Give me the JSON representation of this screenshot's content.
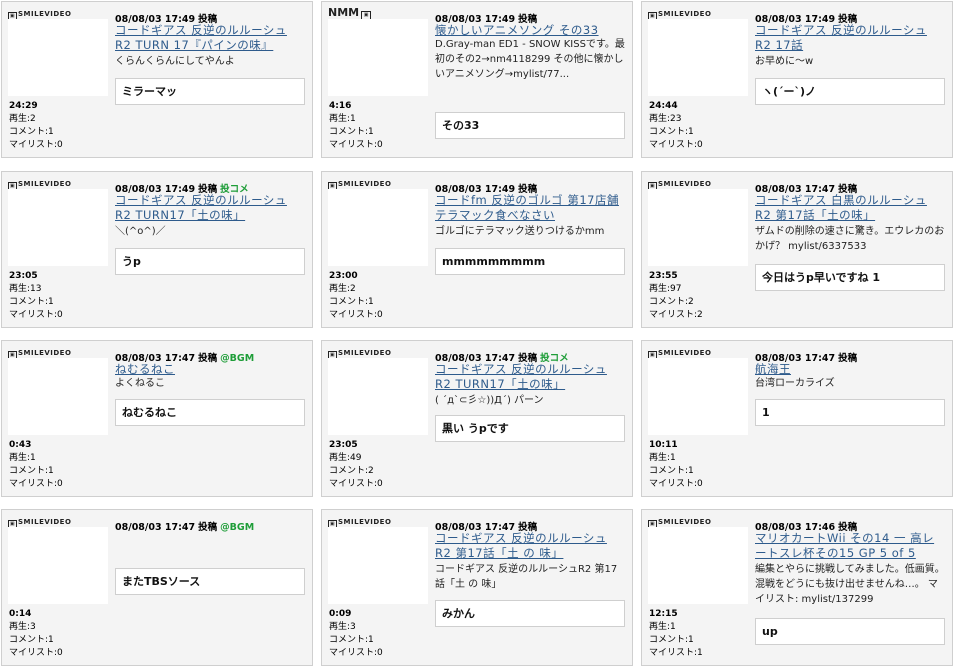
{
  "cards": [
    {
      "logo": "SMILEVIDEO",
      "logo_style": "smile",
      "date": "08/08/03 17:49",
      "kind": "投稿",
      "tag": "",
      "title": "コードギアス 反逆のルルーシュ R2 TURN 17『パインの味』",
      "desc": "くらんくらんにしてやんよ",
      "comment": "ミラーマッ",
      "length": "24:29",
      "plays": "再生:2",
      "comments": "コメント:1",
      "mylist": "マイリスト:0"
    },
    {
      "logo": "NMM",
      "logo_style": "nmm",
      "date": "08/08/03 17:49",
      "kind": "投稿",
      "tag": "",
      "title": "懐かしいアニメソング その33",
      "desc": "D.Gray-man ED1 - SNOW KISSです。最初のその2→nm4118299 その他に懐かしいアニメソング→mylist/77...",
      "comment": "その33",
      "length": "4:16",
      "plays": "再生:1",
      "comments": "コメント:1",
      "mylist": "マイリスト:0"
    },
    {
      "logo": "SMILEVIDEO",
      "logo_style": "smile",
      "date": "08/08/03 17:49",
      "kind": "投稿",
      "tag": "",
      "title": "コードギアス 反逆のルルーシュ R2 17話",
      "desc": "お早めに～w",
      "comment": "ヽ(´ー`)ノ",
      "length": "24:44",
      "plays": "再生:23",
      "comments": "コメント:1",
      "mylist": "マイリスト:0"
    },
    {
      "logo": "SMILEVIDEO",
      "logo_style": "smile",
      "date": "08/08/03 17:49",
      "kind": "投稿",
      "tag": "投コメ",
      "title": "コードギアス 反逆のルルーシュ R2 TURN17「土の味」",
      "desc": "＼(^o^)／",
      "comment": "うp",
      "length": "23:05",
      "plays": "再生:13",
      "comments": "コメント:1",
      "mylist": "マイリスト:0"
    },
    {
      "logo": "SMILEVIDEO",
      "logo_style": "smile",
      "date": "08/08/03 17:49",
      "kind": "投稿",
      "tag": "",
      "title": "コードfm 反逆のゴルゴ 第17店舗 テラマック食べなさい",
      "desc": "ゴルゴにテラマック送りつけるかmm",
      "comment": "mmmmmmmmm",
      "length": "23:00",
      "plays": "再生:2",
      "comments": "コメント:1",
      "mylist": "マイリスト:0"
    },
    {
      "logo": "SMILEVIDEO",
      "logo_style": "smile",
      "date": "08/08/03 17:47",
      "kind": "投稿",
      "tag": "",
      "title": "コードギアス 白黒のルルーシュ R2 第17話「土の味」",
      "desc": "ザムドの削除の速さに驚き。エウレカのおかげ？ mylist/6337533",
      "comment": "今日はうp早いですね 1",
      "length": "23:55",
      "plays": "再生:97",
      "comments": "コメント:2",
      "mylist": "マイリスト:2"
    },
    {
      "logo": "SMILEVIDEO",
      "logo_style": "smile",
      "date": "08/08/03 17:47",
      "kind": "投稿",
      "tag": "@BGM",
      "title": "ねむるねこ",
      "desc": "よくねるこ",
      "comment": "ねむるねこ",
      "length": "0:43",
      "plays": "再生:1",
      "comments": "コメント:1",
      "mylist": "マイリスト:0"
    },
    {
      "logo": "SMILEVIDEO",
      "logo_style": "smile",
      "date": "08/08/03 17:47",
      "kind": "投稿",
      "tag": "投コメ",
      "title": "コードギアス 反逆のルルーシュ R2 TURN17「土の味」",
      "desc": "( ´д`⊂彡☆))Д´) パーン",
      "comment": "黒い うpです",
      "length": "23:05",
      "plays": "再生:49",
      "comments": "コメント:2",
      "mylist": "マイリスト:0"
    },
    {
      "logo": "SMILEVIDEO",
      "logo_style": "smile",
      "date": "08/08/03 17:47",
      "kind": "投稿",
      "tag": "",
      "title": "航海王",
      "desc": "台湾ローカライズ",
      "comment": "1",
      "length": "10:11",
      "plays": "再生:1",
      "comments": "コメント:1",
      "mylist": "マイリスト:0"
    },
    {
      "logo": "SMILEVIDEO",
      "logo_style": "smile",
      "date": "08/08/03 17:47",
      "kind": "投稿",
      "tag": "@BGM",
      "title": "",
      "desc": "",
      "comment": "またTBSソース",
      "length": "0:14",
      "plays": "再生:3",
      "comments": "コメント:1",
      "mylist": "マイリスト:0"
    },
    {
      "logo": "SMILEVIDEO",
      "logo_style": "smile",
      "date": "08/08/03 17:47",
      "kind": "投稿",
      "tag": "",
      "title": "コードギアス 反逆のルルーシュ R2 第17話「土 の 味」",
      "desc": "コードギアス 反逆のルルーシュR2 第17話「土 の 味」",
      "comment": "みかん",
      "length": "0:09",
      "plays": "再生:3",
      "comments": "コメント:1",
      "mylist": "マイリスト:0"
    },
    {
      "logo": "SMILEVIDEO",
      "logo_style": "smile",
      "date": "08/08/03 17:46",
      "kind": "投稿",
      "tag": "",
      "title": "マリオカートWii その14 一 高レートスレ杯その15 GP 5 of 5",
      "desc": "編集とやらに挑戦してみました。低画質。混戦をどうにも抜け出せませんね…。 マイリスト: mylist/137299",
      "comment": "up",
      "length": "12:15",
      "plays": "再生:1",
      "comments": "コメント:1",
      "mylist": "マイリスト:1"
    }
  ]
}
